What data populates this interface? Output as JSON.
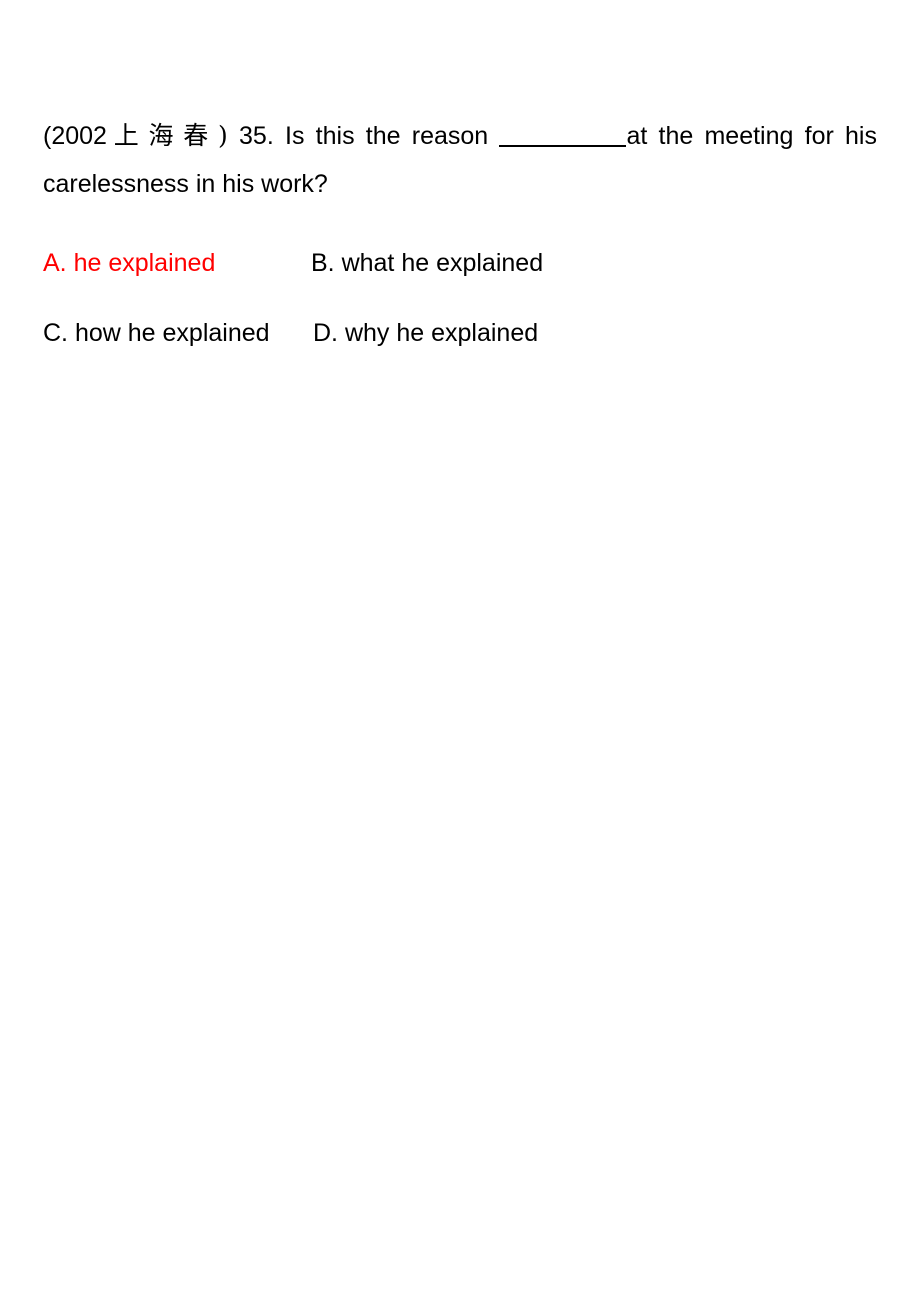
{
  "document": {
    "background_color": "#ffffff",
    "text_color": "#000000",
    "answer_color": "#ff0000"
  },
  "question": {
    "source_label_open": "(2002",
    "source_label_cjk": "上海春",
    "source_label_close": ")",
    "number": "35.",
    "stem_before_blank": "Is this the reason",
    "blank": "__________",
    "stem_after_blank": "at the meeting for his",
    "stem_line2": "carelessness in his work?",
    "full_text": "(2002 上海春) 35. Is this the reason __________at the meeting for his carelessness in his work?"
  },
  "options": [
    {
      "letter": "A.",
      "text": "he explained",
      "label": "A. he explained",
      "is_answer": true,
      "color": "#ff0000"
    },
    {
      "letter": "B.",
      "text": "what he explained",
      "label": "B. what he explained",
      "is_answer": false,
      "color": "#000000"
    },
    {
      "letter": "C.",
      "text": "how he explained",
      "label": "C. how he explained",
      "is_answer": false,
      "color": "#000000"
    },
    {
      "letter": "D.",
      "text": "why he explained",
      "label": "D. why he explained",
      "is_answer": false,
      "color": "#000000"
    }
  ]
}
